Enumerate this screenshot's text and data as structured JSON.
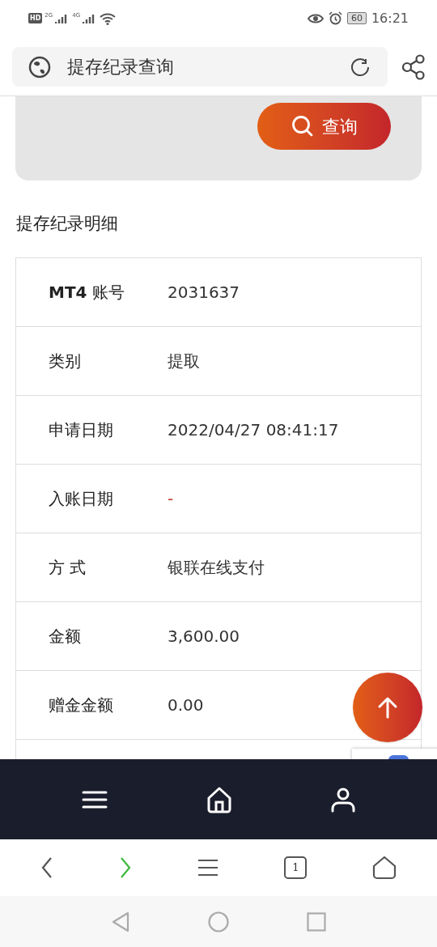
{
  "status_bar": {
    "hd_label": "HD",
    "battery": "60",
    "time": "16:21",
    "network_labels": [
      "2G",
      "4G"
    ]
  },
  "address_bar": {
    "title": "提存纪录查询"
  },
  "search_button": {
    "label": "查询"
  },
  "section_title": "提存纪录明细",
  "details": [
    {
      "label": "**MT4** 账号",
      "value": "2031637",
      "kind": "text"
    },
    {
      "label": "类别",
      "value": "提取",
      "kind": "text"
    },
    {
      "label": "申请日期",
      "value": "2022/04/27 08:41:17",
      "kind": "text"
    },
    {
      "label": "入账日期",
      "value": "-",
      "kind": "dash"
    },
    {
      "label": "方 式",
      "value": "银联在线支付",
      "kind": "text"
    },
    {
      "label": "金额",
      "value": "3,600.00",
      "kind": "text"
    },
    {
      "label": "赠金金额",
      "value": "0.00",
      "kind": "text"
    }
  ],
  "browser_toolbar": {
    "tab_count": "1"
  }
}
